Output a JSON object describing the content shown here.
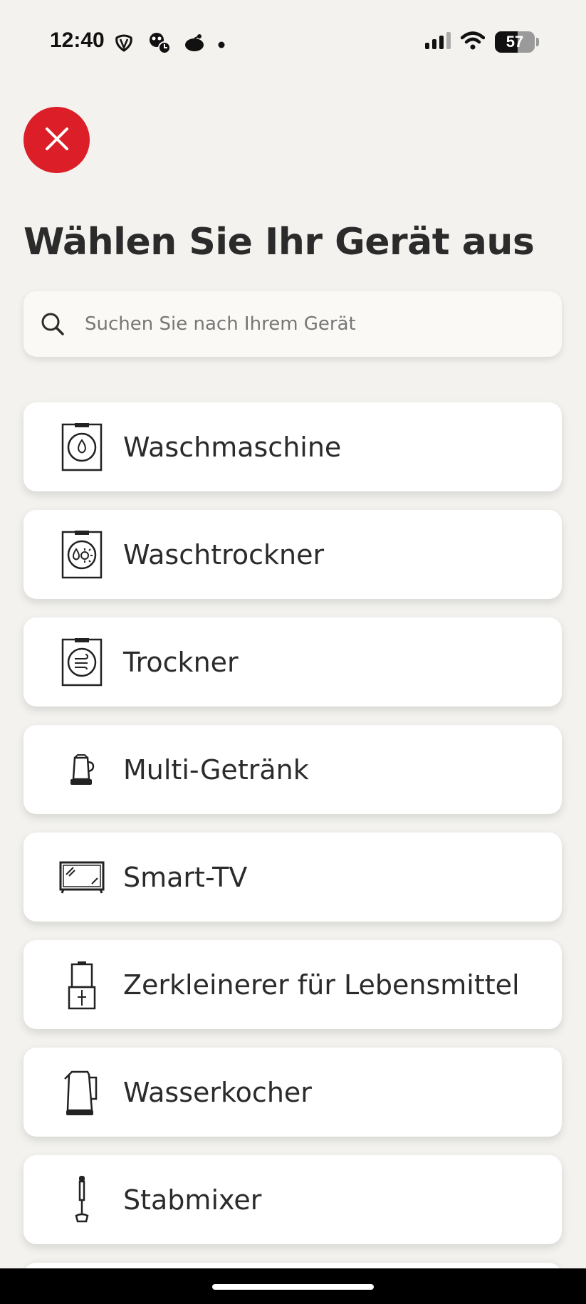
{
  "status_bar": {
    "time": "12:40",
    "battery_level": "57",
    "battery_fraction": 0.57,
    "icons_left": [
      "app-notification-icon",
      "app-notification-icon",
      "app-notification-icon",
      "dot-icon"
    ],
    "icons_right": [
      "cellular-signal-icon",
      "wifi-icon",
      "battery-icon"
    ]
  },
  "close_button": {
    "icon": "close-icon",
    "color": "#dc1e28"
  },
  "page_title": "Wählen Sie Ihr Gerät aus",
  "search": {
    "placeholder": "Suchen Sie nach Ihrem Gerät",
    "value": "",
    "icon": "search-icon"
  },
  "devices": [
    {
      "label": "Waschmaschine",
      "icon": "washing-machine-icon"
    },
    {
      "label": "Waschtrockner",
      "icon": "washer-dryer-icon"
    },
    {
      "label": "Trockner",
      "icon": "dryer-icon"
    },
    {
      "label": "Multi-Getränk",
      "icon": "multi-drink-icon"
    },
    {
      "label": "Smart-TV",
      "icon": "tv-icon"
    },
    {
      "label": "Zerkleinerer für Lebensmittel",
      "icon": "food-chopper-icon"
    },
    {
      "label": "Wasserkocher",
      "icon": "kettle-icon"
    },
    {
      "label": "Stabmixer",
      "icon": "hand-blender-icon"
    }
  ],
  "colors": {
    "accent": "#dc1e28",
    "background": "#f3f2ef",
    "card": "#ffffff"
  }
}
